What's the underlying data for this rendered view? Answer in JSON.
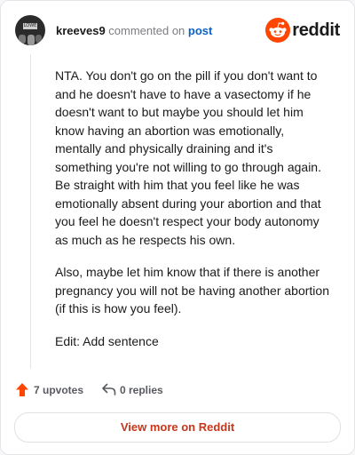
{
  "header": {
    "username": "kreeves9",
    "action_text": "commented on",
    "post_link": "post",
    "brand_name": "reddit",
    "avatar_label": "LOWE"
  },
  "comment": {
    "paragraphs": [
      "NTA. You don't go on the pill if you don't want to and he doesn't have to have a vasectomy if he doesn't want to but maybe you should let him know having an abortion was emotionally, mentally and physically draining and it's something you're not willing to go through again. Be straight with him that you feel like he was emotionally absent during your abortion and that you feel he doesn't respect your body autonomy as much as he respects his own.",
      "Also, maybe let him know that if there is another pregnancy you will not be having another abortion (if this is how you feel).",
      "Edit: Add sentence"
    ]
  },
  "actions": {
    "upvotes": "7 upvotes",
    "replies": "0 replies"
  },
  "footer": {
    "view_more_label": "View more on Reddit"
  },
  "colors": {
    "brand": "#ff4500",
    "link": "#0a62c9",
    "button_text": "#c8361b"
  }
}
